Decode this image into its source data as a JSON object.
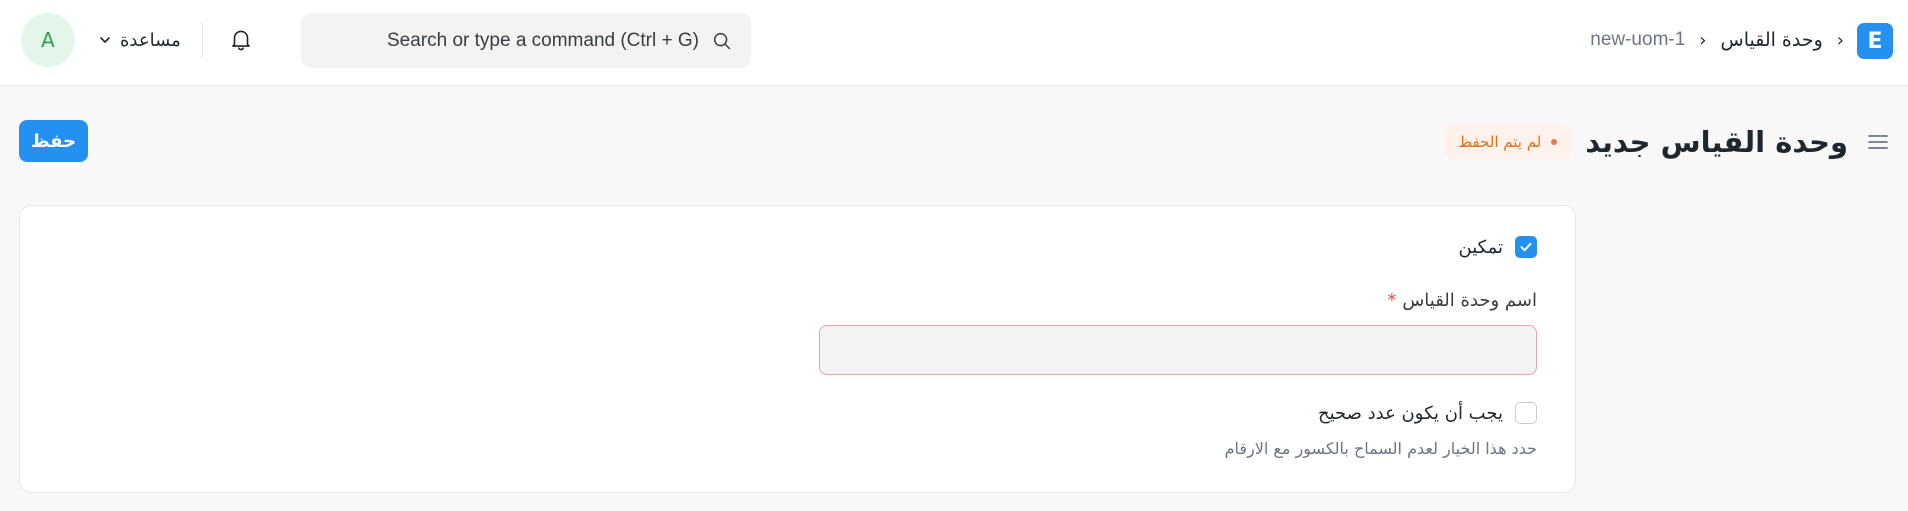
{
  "navbar": {
    "avatar_letter": "A",
    "help_label": "مساعدة",
    "search_placeholder": "Search or type a command (Ctrl + G)",
    "breadcrumb": {
      "list": "وحدة القياس",
      "separator": "›",
      "separator2": "›",
      "doc": "new-uom-1"
    },
    "logo_letter": "E"
  },
  "page_head": {
    "title": "وحدة القياس جديد",
    "status": "لم يتم الحفظ",
    "save_label": "حفظ"
  },
  "form": {
    "enabled_label": "تمكين",
    "enabled_checked": true,
    "uom_name_label": "اسم وحدة القياس",
    "uom_name_required_mark": "*",
    "uom_name_value": "",
    "whole_number_label": "يجب أن يكون عدد صحيح",
    "whole_number_checked": false,
    "whole_number_help": "حدد هذا الخيار لعدم السماح بالكسور مع الارقام"
  },
  "colors": {
    "primary": "#2490ef",
    "status_text": "#e86c13",
    "status_bg": "#fff2ec",
    "required": "#e24c4c"
  }
}
